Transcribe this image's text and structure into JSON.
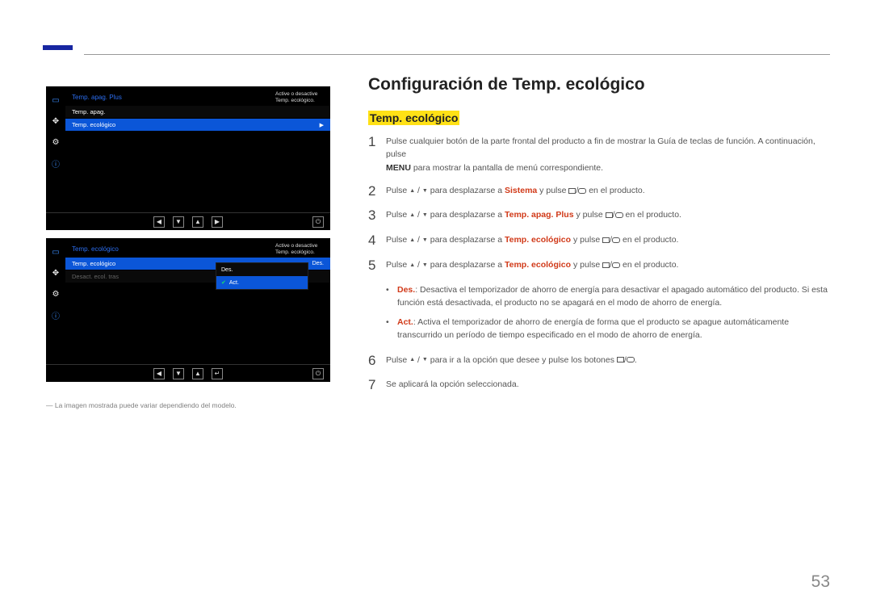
{
  "header": {},
  "osd1": {
    "title": "Temp. apag. Plus",
    "row1": "Temp. apag.",
    "row2": "Temp. ecológico",
    "hint1": "Active o desactive",
    "hint2": "Temp. ecológico."
  },
  "osd2": {
    "title": "Temp. ecológico",
    "row1": "Temp. ecológico",
    "row1v": "Des.",
    "row2": "Desact. ecol. tras",
    "sub1": "Des.",
    "sub2": "Act.",
    "hint1": "Active o desactive",
    "hint2": "Temp. ecológico."
  },
  "leftNote": "― La imagen mostrada puede variar dependiendo del modelo.",
  "main": {
    "title": "Configuración de Temp. ecológico",
    "subtitle": "Temp. ecológico"
  },
  "steps": {
    "s1a": "Pulse cualquier botón de la parte frontal del producto a fin de mostrar la Guía de teclas de función. A continuación, pulse ",
    "s1menu": "MENU",
    "s1b": " para mostrar la pantalla de menú correspondiente.",
    "s2a": "Pulse ",
    "s2mid": " para desplazarse a ",
    "s2kw": "Sistema",
    "s2b": " y pulse ",
    "s2c": " en el producto.",
    "s3kw": "Temp. apag. Plus",
    "s4kw": "Temp. ecológico",
    "s5kw": "Temp. ecológico",
    "s6a": "Pulse ",
    "s6b": " para ir a la opción que desee y pulse los botones ",
    "s6c": ".",
    "s7": "Se aplicará la opción seleccionada."
  },
  "bullets": {
    "b1kw": "Des.",
    "b1": ": Desactiva el temporizador de ahorro de energía para desactivar el apagado automático del producto. Si esta función está desactivada, el producto no se apagará en el modo de ahorro de energía.",
    "b2kw": "Act.",
    "b2": ": Activa el temporizador de ahorro de energía de forma que el producto se apague automáticamente transcurrido un período de tiempo especificado en el modo de ahorro de energía."
  },
  "pageNum": "53"
}
